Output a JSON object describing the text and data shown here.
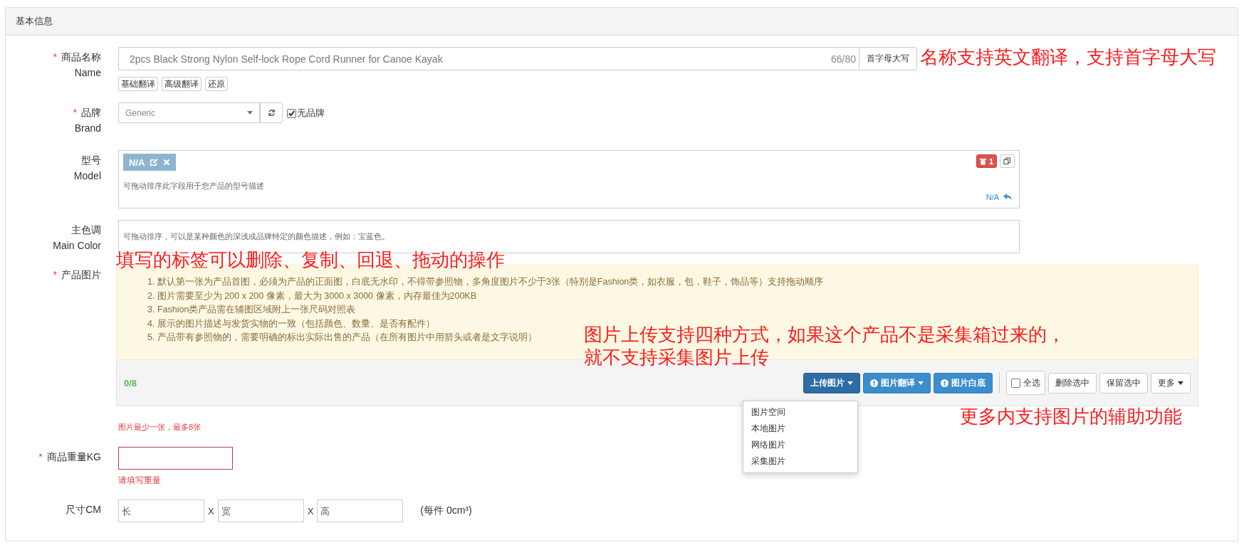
{
  "panel": {
    "title": "基本信息"
  },
  "name_field": {
    "required_mark": "*",
    "label": "商品名称",
    "label_en": "Name",
    "value": "2pcs Black Strong Nylon Self-lock Rope Cord Runner for Canoe Kayak",
    "counter": "66/80",
    "action": "首字母大写",
    "buttons": [
      "基础翻译",
      "高级翻译",
      "还原"
    ]
  },
  "brand_field": {
    "required_mark": "*",
    "label": "品牌",
    "label_en": "Brand",
    "value": "Generic",
    "no_brand": {
      "label": "无品牌",
      "checked": true
    }
  },
  "model_field": {
    "label": "型号",
    "label_en": "Model",
    "tags": [
      "N/A"
    ],
    "delete_count": "1",
    "hint": "可拖动排序此字段用于您产品的型号描述",
    "default_link": "N/A"
  },
  "color_field": {
    "label": "主色调",
    "label_en": "Main Color",
    "hint": "可拖动排序，可以是某种颜色的深浅或品牌特定的颜色描述，例如：宝蓝色。"
  },
  "image_field": {
    "required_mark": "*",
    "label": "产品图片",
    "rules": [
      "1. 默认第一张为产品首图，必须为产品的正面图，白底无水印，不得带参照物，多角度图片不少于3张（特别是Fashion类，如衣服，包，鞋子，饰品等）支持拖动顺序",
      "2. 图片需要至少为 200 x 200 像素，最大为 3000 x 3000 像素，内存最佳为200KB",
      "3. Fashion类产品需在辅图区域附上一张尺码对照表",
      "4. 展示的图片描述与发货实物的一致（包括颜色、数量、是否有配件）",
      "5. 产品带有参照物的，需要明确的标出实际出售的产品（在所有图片中用箭头或者是文字说明）"
    ],
    "count": "0/8",
    "actions": [
      {
        "kind": "upload",
        "label": "上传图片",
        "caret": true
      },
      {
        "kind": "primary",
        "label": "图片翻译",
        "caret": true,
        "info": true
      },
      {
        "kind": "primary",
        "label": "图片白底",
        "info": true
      },
      {
        "kind": "checkbox",
        "label": "全选",
        "checked": false
      },
      {
        "kind": "default",
        "label": "删除选中"
      },
      {
        "kind": "default",
        "label": "保留选中"
      },
      {
        "kind": "default",
        "label": "更多",
        "caret": true
      }
    ],
    "upload_menu": [
      "图片空间",
      "本地图片",
      "网络图片",
      "采集图片"
    ],
    "help": "图片最少一张，最多8张"
  },
  "weight_field": {
    "required_mark": "*",
    "label": "商品重量KG",
    "error": "请填写重量"
  },
  "size_field": {
    "label": "尺寸CM",
    "placeholders": [
      "长",
      "宽",
      "高"
    ],
    "separators": [
      "X",
      "X"
    ],
    "volume": "(每件 0cm³)"
  },
  "annotations": [
    "名称支持英文翻译，支持首字母大写",
    "填写的标签可以删除、复制、回退、拖动的操作",
    "图片上传支持四种方式，如果这个产品不是采集箱过来的，",
    "就不支持采集图片上传",
    "更多内支持图片的辅助功能"
  ]
}
